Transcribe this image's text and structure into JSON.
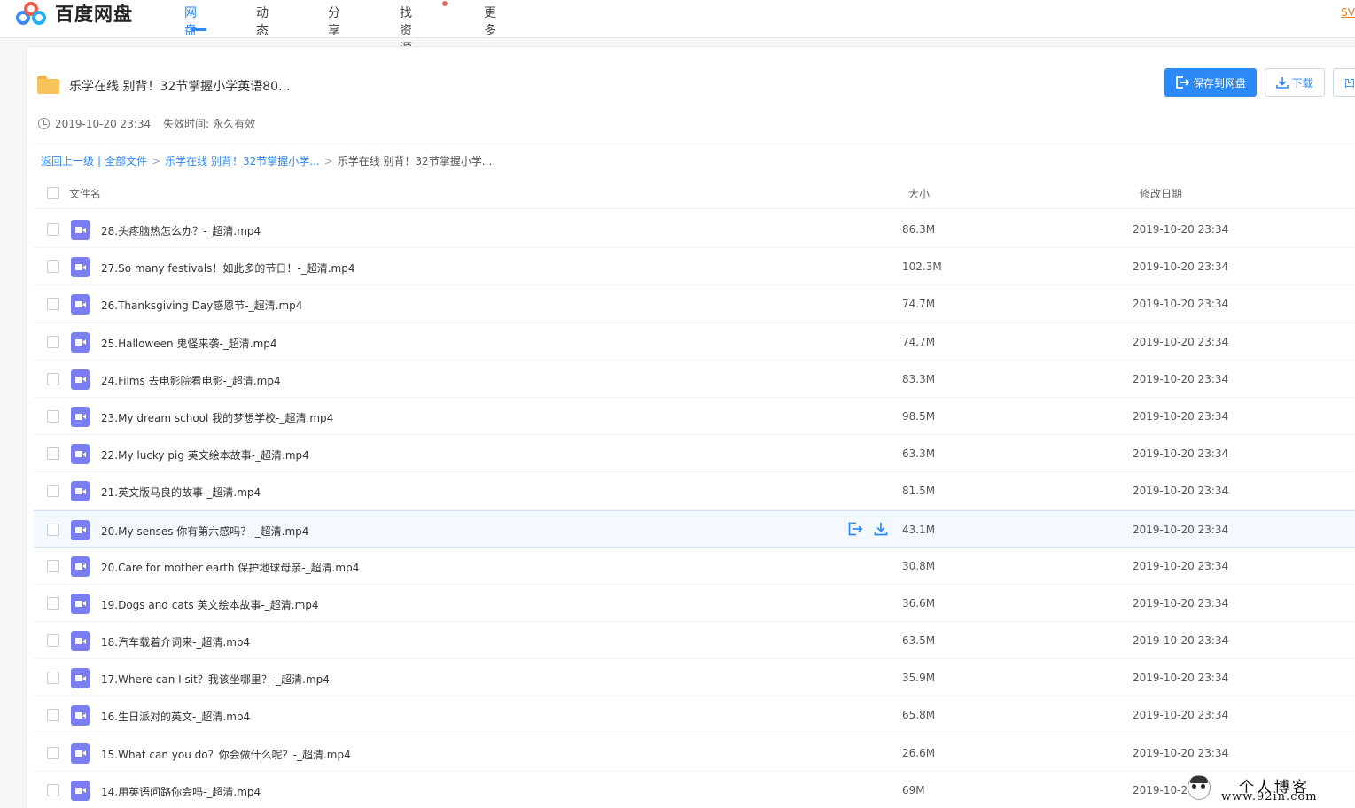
{
  "app": {
    "logo_text": "百度网盘",
    "accent_color": "#2b8af7"
  },
  "nav": {
    "items": [
      {
        "label": "网盘",
        "active": true
      },
      {
        "label": "动态",
        "active": false
      },
      {
        "label": "分享",
        "active": false
      },
      {
        "label": "找资源",
        "active": false
      },
      {
        "label": "更多",
        "active": false
      }
    ],
    "user_text": "SV"
  },
  "share": {
    "title": "乐学在线 别背！32节掌握小学英语80...",
    "created": "2019-10-20 23:34",
    "expire_label": "失效时间:",
    "expire_value": "永久有效",
    "save_button": "保存到网盘",
    "download_button": "下载",
    "more_button": "凹"
  },
  "breadcrumb": {
    "back": "返回上一级",
    "divider": "|",
    "all_files": "全部文件",
    "sep": ">",
    "parent": "乐学在线 别背！32节掌握小学...",
    "current": "乐学在线 别背！32节掌握小学..."
  },
  "list": {
    "columns": {
      "name": "文件名",
      "size": "大小",
      "date": "修改日期"
    },
    "rows": [
      {
        "name": "28.头疼脑热怎么办？-_超清.mp4",
        "size": "86.3M",
        "date": "2019-10-20 23:34"
      },
      {
        "name": "27.So many festivals！如此多的节日！-_超清.mp4",
        "size": "102.3M",
        "date": "2019-10-20 23:34"
      },
      {
        "name": "26.Thanksgiving Day感恩节-_超清.mp4",
        "size": "74.7M",
        "date": "2019-10-20 23:34"
      },
      {
        "name": "25.Halloween 鬼怪来袭-_超清.mp4",
        "size": "74.7M",
        "date": "2019-10-20 23:34"
      },
      {
        "name": "24.Films 去电影院看电影-_超清.mp4",
        "size": "83.3M",
        "date": "2019-10-20 23:34"
      },
      {
        "name": "23.My dream school 我的梦想学校-_超清.mp4",
        "size": "98.5M",
        "date": "2019-10-20 23:34"
      },
      {
        "name": "22.My lucky pig 英文绘本故事-_超清.mp4",
        "size": "63.3M",
        "date": "2019-10-20 23:34"
      },
      {
        "name": "21.英文版马良的故事-_超清.mp4",
        "size": "81.5M",
        "date": "2019-10-20 23:34"
      },
      {
        "name": "20.My senses 你有第六感吗？-_超清.mp4",
        "size": "43.1M",
        "date": "2019-10-20 23:34"
      },
      {
        "name": "20.Care for mother earth 保护地球母亲-_超清.mp4",
        "size": "30.8M",
        "date": "2019-10-20 23:34"
      },
      {
        "name": "19.Dogs and cats 英文绘本故事-_超清.mp4",
        "size": "36.6M",
        "date": "2019-10-20 23:34"
      },
      {
        "name": "18.汽车载着介词来-_超清.mp4",
        "size": "63.5M",
        "date": "2019-10-20 23:34"
      },
      {
        "name": "17.Where can I sit？我该坐哪里？-_超清.mp4",
        "size": "35.9M",
        "date": "2019-10-20 23:34"
      },
      {
        "name": "16.生日派对的英文-_超清.mp4",
        "size": "65.8M",
        "date": "2019-10-20 23:34"
      },
      {
        "name": "15.What can you do？你会做什么呢？-_超清.mp4",
        "size": "26.6M",
        "date": "2019-10-20 23:34"
      },
      {
        "name": "14.用英语问路你会吗-_超清.mp4",
        "size": "69M",
        "date": "2019-10-2"
      }
    ]
  },
  "watermark": {
    "title": "个人博客",
    "url": "www.92in.com"
  }
}
